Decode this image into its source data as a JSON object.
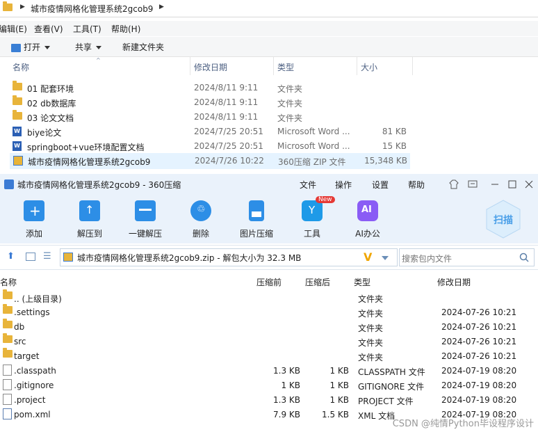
{
  "explorer": {
    "breadcrumb": "城市疫情网格化管理系统2gcob9",
    "menu": [
      "编辑(E)",
      "查看(V)",
      "工具(T)",
      "帮助(H)"
    ],
    "toolbar": {
      "open": "打开",
      "share": "共享",
      "new_folder": "新建文件夹"
    },
    "columns": [
      "名称",
      "修改日期",
      "类型",
      "大小"
    ],
    "rows": [
      {
        "name": "01 配套环境",
        "date": "2024/8/11 9:11",
        "type": "文件夹",
        "size": "",
        "icon": "folder-icon"
      },
      {
        "name": "02 db数据库",
        "date": "2024/8/11 9:11",
        "type": "文件夹",
        "size": "",
        "icon": "folder-icon"
      },
      {
        "name": "03 论文文档",
        "date": "2024/8/11 9:11",
        "type": "文件夹",
        "size": "",
        "icon": "folder-icon"
      },
      {
        "name": "biye论文",
        "date": "2024/7/25 20:51",
        "type": "Microsoft Word ...",
        "size": "81 KB",
        "icon": "word-doc-icon"
      },
      {
        "name": "springboot+vue环境配置文档",
        "date": "2024/7/25 20:51",
        "type": "Microsoft Word ...",
        "size": "15 KB",
        "icon": "word-doc-icon"
      },
      {
        "name": "城市疫情网格化管理系统2gcob9",
        "date": "2024/7/26 10:22",
        "type": "360压缩 ZIP 文件",
        "size": "15,348 KB",
        "icon": "zip-icon"
      }
    ]
  },
  "zip": {
    "title": "城市疫情网格化管理系统2gcob9 - 360压缩",
    "menu": [
      "文件",
      "操作",
      "设置",
      "帮助"
    ],
    "tools": [
      {
        "label": "添加",
        "icon": "add-icon",
        "color": "#2d8ee6"
      },
      {
        "label": "解压到",
        "icon": "extract-to-icon",
        "color": "#2d8ee6"
      },
      {
        "label": "一键解压",
        "icon": "one-click-extract-icon",
        "color": "#2d8ee6"
      },
      {
        "label": "删除",
        "icon": "delete-icon",
        "color": "#2d8ee6"
      },
      {
        "label": "图片压缩",
        "icon": "image-compress-icon",
        "color": "#2d8ee6"
      },
      {
        "label": "工具",
        "icon": "tools-icon",
        "color": "#1e9ae8"
      },
      {
        "label": "AI办公",
        "icon": "ai-office-icon",
        "color": "#8a5cf5"
      }
    ],
    "new_badge": "New",
    "scan_label": "扫描",
    "path": "城市疫情网格化管理系统2gcob9.zip - 解包大小为 32.3 MB",
    "search_placeholder": "搜索包内文件",
    "columns": [
      "名称",
      "压缩前",
      "压缩后",
      "类型",
      "修改日期"
    ],
    "rows": [
      {
        "name": ".. (上级目录)",
        "before": "",
        "after": "",
        "type": "文件夹",
        "date": "",
        "icon": "folder-icon"
      },
      {
        "name": ".settings",
        "before": "",
        "after": "",
        "type": "文件夹",
        "date": "2024-07-26 10:21",
        "icon": "folder-icon"
      },
      {
        "name": "db",
        "before": "",
        "after": "",
        "type": "文件夹",
        "date": "2024-07-26 10:21",
        "icon": "folder-icon"
      },
      {
        "name": "src",
        "before": "",
        "after": "",
        "type": "文件夹",
        "date": "2024-07-26 10:21",
        "icon": "folder-icon"
      },
      {
        "name": "target",
        "before": "",
        "after": "",
        "type": "文件夹",
        "date": "2024-07-26 10:21",
        "icon": "folder-icon"
      },
      {
        "name": ".classpath",
        "before": "1.3 KB",
        "after": "1 KB",
        "type": "CLASSPATH 文件",
        "date": "2024-07-19 08:20",
        "icon": "file-icon"
      },
      {
        "name": ".gitignore",
        "before": "1 KB",
        "after": "1 KB",
        "type": "GITIGNORE 文件",
        "date": "2024-07-19 08:20",
        "icon": "file-icon"
      },
      {
        "name": ".project",
        "before": "1.3 KB",
        "after": "1 KB",
        "type": "PROJECT 文件",
        "date": "2024-07-19 08:20",
        "icon": "file-icon"
      },
      {
        "name": "pom.xml",
        "before": "7.9 KB",
        "after": "1.5 KB",
        "type": "XML 文档",
        "date": "2024-07-19 08:20",
        "icon": "xml-file-icon"
      }
    ]
  },
  "watermark": "CSDN @纯情Python毕设程序设计"
}
